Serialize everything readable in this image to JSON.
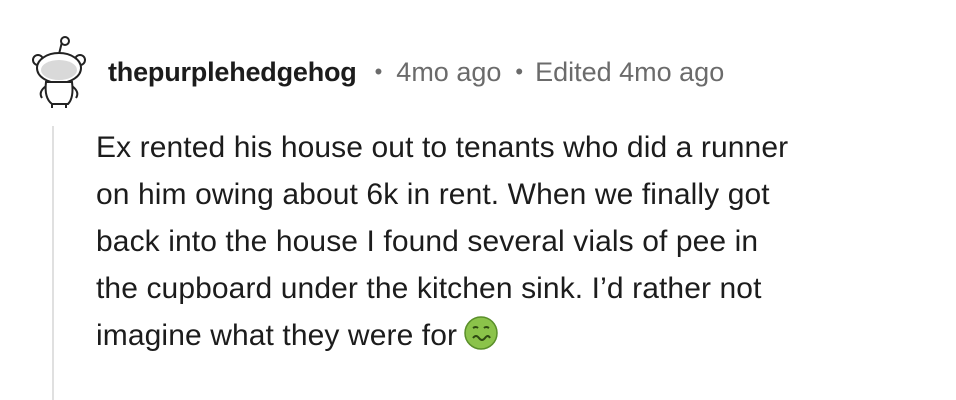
{
  "comment": {
    "author": "thepurplehedgehog",
    "separator": "•",
    "time": "4mo ago",
    "edited": "Edited 4mo ago",
    "body_lines": [
      "Ex rented his house out to tenants who did a runner",
      "on him owing about 6k in rent. When we finally got",
      "back into the house I found several vials of pee in",
      "the cupboard under the kitchen sink. I’d rather not",
      "imagine what they were for"
    ],
    "emoji": "nauseated-face-emoji",
    "avatar_icon": "snoo-avatar-icon",
    "colors": {
      "text": "#1c1c1c",
      "meta": "#6b6b6b",
      "thread_line": "#e0e0e0",
      "emoji_green": "#8bc34a"
    }
  }
}
